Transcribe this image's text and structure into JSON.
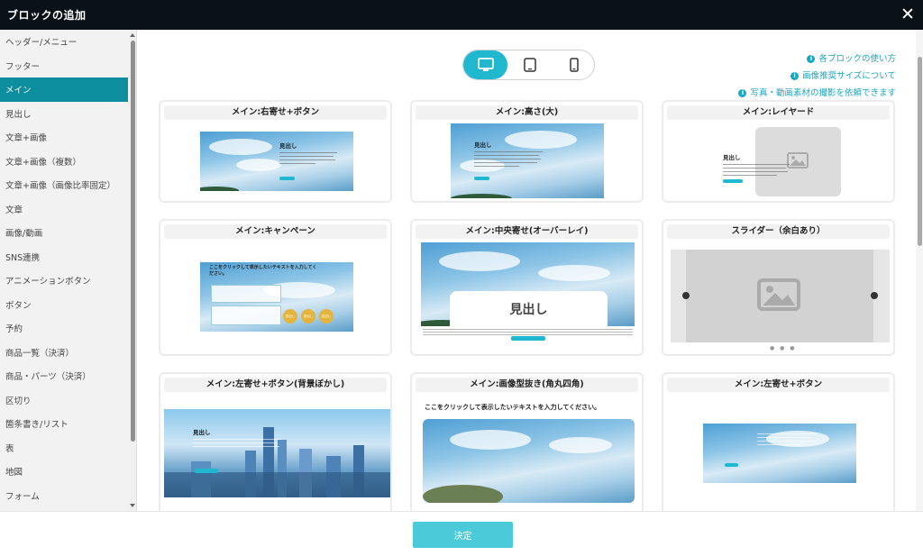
{
  "dialog": {
    "title": "ブロックの追加",
    "close_icon": "close-icon"
  },
  "sidebar": {
    "active_index": 2,
    "items": [
      {
        "label": "ヘッダー/メニュー"
      },
      {
        "label": "フッター"
      },
      {
        "label": "メイン"
      },
      {
        "label": "見出し"
      },
      {
        "label": "文章+画像"
      },
      {
        "label": "文章+画像（複数）"
      },
      {
        "label": "文章+画像（画像比率固定）"
      },
      {
        "label": "文章"
      },
      {
        "label": "画像/動画"
      },
      {
        "label": "SNS連携"
      },
      {
        "label": "アニメーションボタン"
      },
      {
        "label": "ボタン"
      },
      {
        "label": "予約"
      },
      {
        "label": "商品一覧（決済）"
      },
      {
        "label": "商品・パーツ（決済）"
      },
      {
        "label": "区切り"
      },
      {
        "label": "箇条書き/リスト"
      },
      {
        "label": "表"
      },
      {
        "label": "地図"
      },
      {
        "label": "フォーム"
      }
    ]
  },
  "device_toggle": {
    "options": [
      {
        "name": "desktop",
        "icon": "desktop-icon",
        "active": true
      },
      {
        "name": "tablet",
        "icon": "tablet-icon",
        "active": false
      },
      {
        "name": "mobile",
        "icon": "mobile-icon",
        "active": false
      }
    ]
  },
  "help_links": [
    {
      "label": "各ブロックの使い方"
    },
    {
      "label": "画像推奨サイズについて"
    },
    {
      "label": "写真・動画素材の撮影を依頼できます"
    }
  ],
  "cards": [
    {
      "title": "メイン:右寄せ+ボタン",
      "heading": "見出し"
    },
    {
      "title": "メイン:高さ(大)",
      "heading": "見出し"
    },
    {
      "title": "メイン:レイヤード",
      "heading": "見出し"
    },
    {
      "title": "メイン:キャンペーン",
      "heading": "ここをクリックして表示したいテキストを入力してください。"
    },
    {
      "title": "メイン:中央寄せ(オーバーレイ)",
      "heading": "見出し"
    },
    {
      "title": "スライダー（余白あり）"
    },
    {
      "title": "メイン:左寄せ+ボタン(背景ぼかし)",
      "heading": "見出し"
    },
    {
      "title": "メイン:画像型抜き(角丸四角)",
      "heading": "ここをクリックして表示したいテキストを入力してください。"
    },
    {
      "title": "メイン:左寄せ+ボタン"
    }
  ],
  "campaign_badges": [
    "見出し",
    "見出し",
    "見出し"
  ],
  "footer": {
    "decide_label": "決定"
  },
  "colors": {
    "accent": "#1fb8cf",
    "active_sidebar": "#0c8e9f",
    "titlebar": "#0a1117"
  }
}
